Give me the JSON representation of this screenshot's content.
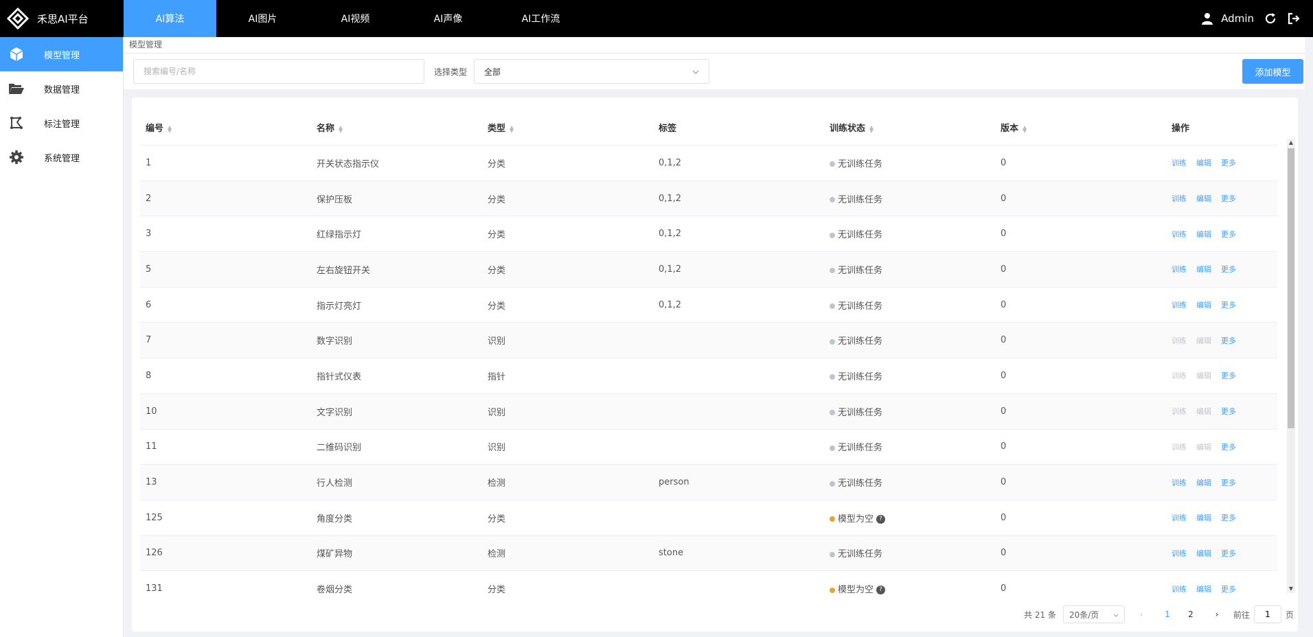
{
  "app": {
    "title": "禾思AI平台"
  },
  "topnav": [
    {
      "label": "AI算法",
      "active": true
    },
    {
      "label": "AI图片"
    },
    {
      "label": "AI视频"
    },
    {
      "label": "AI声像"
    },
    {
      "label": "AI工作流"
    }
  ],
  "user": {
    "name": "Admin"
  },
  "sidebar": [
    {
      "label": "模型管理",
      "icon": "cube-icon",
      "active": true
    },
    {
      "label": "数据管理",
      "icon": "folder-open-icon"
    },
    {
      "label": "标注管理",
      "icon": "annotation-icon"
    },
    {
      "label": "系统管理",
      "icon": "gear-icon"
    }
  ],
  "breadcrumb": "模型管理",
  "filter": {
    "search_placeholder": "搜索编号/名称",
    "type_label": "选择类型",
    "type_value": "全部",
    "add_button": "添加模型"
  },
  "table": {
    "headers": [
      "编号",
      "名称",
      "类型",
      "标签",
      "训练状态",
      "版本",
      "操作"
    ],
    "rows": [
      {
        "id": "1",
        "name": "开关状态指示仪",
        "type": "分类",
        "tags": "0,1,2",
        "status": "无训练任务",
        "version": "0",
        "ops": "all"
      },
      {
        "id": "2",
        "name": "保护压板",
        "type": "分类",
        "tags": "0,1,2",
        "status": "无训练任务",
        "version": "0",
        "ops": "all"
      },
      {
        "id": "3",
        "name": "红绿指示灯",
        "type": "分类",
        "tags": "0,1,2",
        "status": "无训练任务",
        "version": "0",
        "ops": "all"
      },
      {
        "id": "5",
        "name": "左右旋钮开关",
        "type": "分类",
        "tags": "0,1,2",
        "status": "无训练任务",
        "version": "0",
        "ops": "all"
      },
      {
        "id": "6",
        "name": "指示灯亮灯",
        "type": "分类",
        "tags": "0,1,2",
        "status": "无训练任务",
        "version": "0",
        "ops": "all"
      },
      {
        "id": "7",
        "name": "数字识别",
        "type": "识别",
        "tags": "",
        "status": "无训练任务",
        "version": "0",
        "ops": "more"
      },
      {
        "id": "8",
        "name": "指针式仪表",
        "type": "指针",
        "tags": "",
        "status": "无训练任务",
        "version": "0",
        "ops": "more"
      },
      {
        "id": "10",
        "name": "文字识别",
        "type": "识别",
        "tags": "",
        "status": "无训练任务",
        "version": "0",
        "ops": "more"
      },
      {
        "id": "11",
        "name": "二维码识别",
        "type": "识别",
        "tags": "",
        "status": "无训练任务",
        "version": "0",
        "ops": "more"
      },
      {
        "id": "13",
        "name": "行人检测",
        "type": "检测",
        "tags": "person",
        "status": "无训练任务",
        "version": "0",
        "ops": "all"
      },
      {
        "id": "125",
        "name": "角度分类",
        "type": "分类",
        "tags": "",
        "status": "模型为空",
        "warn": true,
        "version": "0",
        "ops": "all"
      },
      {
        "id": "126",
        "name": "煤矿异物",
        "type": "检测",
        "tags": "stone",
        "status": "无训练任务",
        "version": "0",
        "ops": "all"
      },
      {
        "id": "131",
        "name": "卷烟分类",
        "type": "分类",
        "tags": "",
        "status": "模型为空",
        "warn": true,
        "version": "0",
        "ops": "all"
      }
    ],
    "op_labels": {
      "train": "训练",
      "edit": "编辑",
      "more": "更多"
    }
  },
  "pagination": {
    "total": "共 21 条",
    "page_size": "20条/页",
    "pages": [
      "1",
      "2"
    ],
    "current": "1",
    "goto_label": "前往",
    "goto_value": "1",
    "page_unit": "页"
  },
  "colors": {
    "accent": "#409eff",
    "topbar": "#000000",
    "warn": "#e6a23c"
  }
}
